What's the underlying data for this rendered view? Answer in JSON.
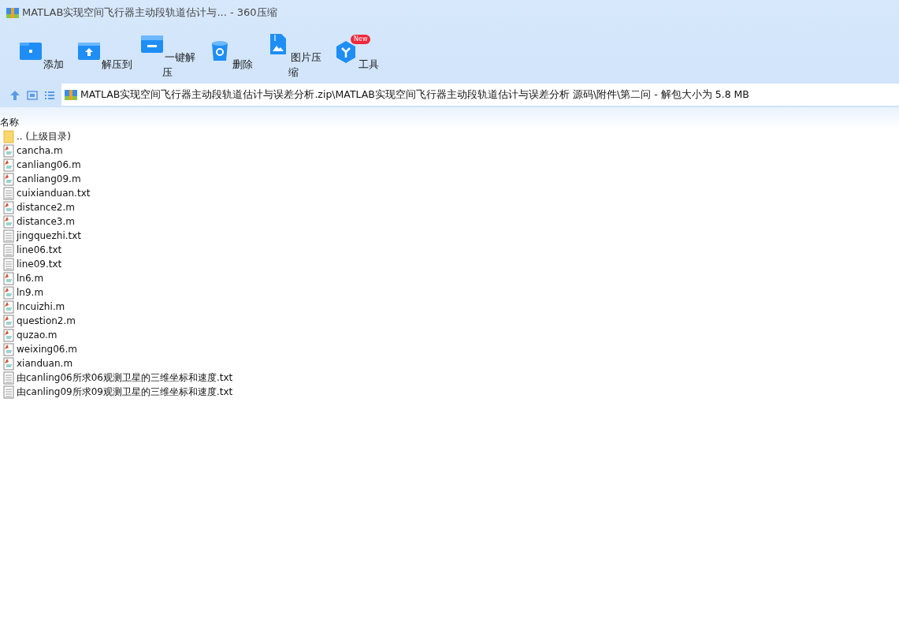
{
  "window": {
    "title": "MATLAB实现空间飞行器主动段轨道估计与... - 360压缩"
  },
  "toolbar": [
    {
      "kind": "add",
      "label": "添加"
    },
    {
      "kind": "extract-to",
      "label": "解压到"
    },
    {
      "kind": "extract",
      "label": "一键解压"
    },
    {
      "kind": "delete",
      "label": "删除"
    },
    {
      "kind": "image",
      "label": "图片压缩"
    },
    {
      "kind": "tools",
      "label": "工具",
      "badge": "New"
    }
  ],
  "address": {
    "path": "MATLAB实现空间飞行器主动段轨道估计与误差分析.zip\\MATLAB实现空间飞行器主动段轨道估计与误差分析 源码\\附件\\第二问 - 解包大小为 5.8 MB"
  },
  "table": {
    "columns": [
      "名称"
    ],
    "rows": [
      {
        "kind": "folder",
        "name": ".. (上级目录)"
      },
      {
        "kind": "m",
        "name": "cancha.m"
      },
      {
        "kind": "m",
        "name": "canliang06.m"
      },
      {
        "kind": "m",
        "name": "canliang09.m"
      },
      {
        "kind": "txt",
        "name": "cuixianduan.txt"
      },
      {
        "kind": "m",
        "name": "distance2.m"
      },
      {
        "kind": "m",
        "name": "distance3.m"
      },
      {
        "kind": "txt",
        "name": "jingquezhi.txt"
      },
      {
        "kind": "txt",
        "name": "line06.txt"
      },
      {
        "kind": "txt",
        "name": "line09.txt"
      },
      {
        "kind": "m",
        "name": "ln6.m"
      },
      {
        "kind": "m",
        "name": "ln9.m"
      },
      {
        "kind": "m",
        "name": "lncuizhi.m"
      },
      {
        "kind": "m",
        "name": "question2.m"
      },
      {
        "kind": "m",
        "name": "quzao.m"
      },
      {
        "kind": "m",
        "name": "weixing06.m"
      },
      {
        "kind": "m",
        "name": "xianduan.m"
      },
      {
        "kind": "txt",
        "name": "由canling06所求06观测卫星的三维坐标和速度.txt"
      },
      {
        "kind": "txt",
        "name": "由canling09所求09观测卫星的三维坐标和速度.txt"
      }
    ]
  }
}
